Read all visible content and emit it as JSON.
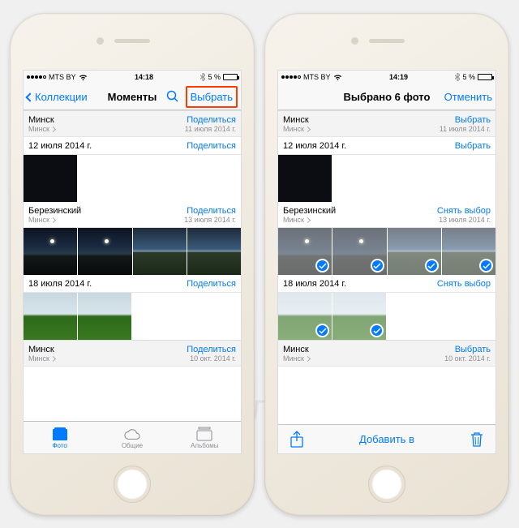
{
  "status": {
    "carrier": "MTS BY",
    "bt_icon": "bluetooth",
    "batt_pct": "5 %"
  },
  "times": {
    "left": "14:18",
    "right": "14:19"
  },
  "nav_left": {
    "back": "Коллекции",
    "title": "Моменты",
    "select": "Выбрать"
  },
  "nav_right": {
    "title": "Выбрано 6 фото",
    "cancel": "Отменить"
  },
  "actions": {
    "share": "Поделиться",
    "select": "Выбрать",
    "deselect": "Снять выбор",
    "addto": "Добавить в"
  },
  "sections": [
    {
      "title": "Минск",
      "sub": "Минск",
      "date": "11 июля 2014 г."
    },
    {
      "title": "12 июля 2014 г.",
      "sub": "",
      "date": ""
    },
    {
      "title": "Березинский",
      "sub": "Минск",
      "date": "13 июля 2014 г."
    },
    {
      "title": "18 июля 2014 г.",
      "sub": "",
      "date": ""
    },
    {
      "title": "Минск",
      "sub": "Минск",
      "date": "10 окт. 2014 г."
    }
  ],
  "tabs": {
    "photos": "Фото",
    "shared": "Общие",
    "albums": "Альбомы"
  },
  "watermark": "Яблык"
}
